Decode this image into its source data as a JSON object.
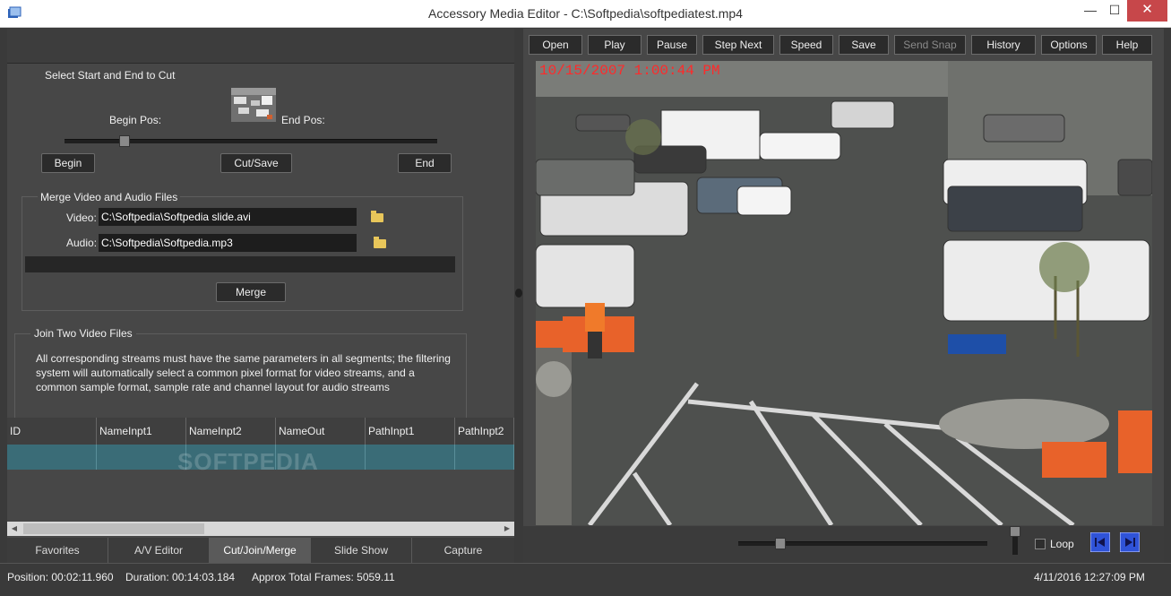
{
  "window": {
    "title": "Accessory Media Editor - C:\\Softpedia\\softpediatest.mp4",
    "min": "—",
    "max": "☐",
    "close": "✕"
  },
  "cut": {
    "heading": "Select Start and End to Cut",
    "begin_pos": "Begin Pos:",
    "end_pos": "End Pos:",
    "begin_btn": "Begin",
    "cutsave_btn": "Cut/Save",
    "end_btn": "End",
    "slider_fraction": 0.16
  },
  "merge": {
    "heading": "Merge Video and Audio Files",
    "video_label": "Video:",
    "video_value": "C:\\Softpedia\\Softpedia slide.avi",
    "audio_label": "Audio:",
    "audio_value": "C:\\Softpedia\\Softpedia.mp3",
    "merge_btn": "Merge"
  },
  "join": {
    "heading": "Join Two Video Files",
    "description": "All corresponding streams must have the same parameters in all segments; the filtering system will automatically select a common pixel format for video streams, and a common sample format, sample rate and channel layout for audio streams"
  },
  "grid": {
    "columns": [
      "ID",
      "NameInpt1",
      "NameInpt2",
      "NameOut",
      "PathInpt1",
      "PathInpt2"
    ]
  },
  "watermark": "SOFTPEDIA",
  "tabs": [
    "Favorites",
    "A/V Editor",
    "Cut/Join/Merge",
    "Slide Show",
    "Capture"
  ],
  "active_tab": "Cut/Join/Merge",
  "toolbar": {
    "open": "Open",
    "play": "Play",
    "pause": "Pause",
    "step_next": "Step Next",
    "speed": "Speed",
    "save": "Save",
    "send_snap": "Send Snap",
    "history": "History",
    "options": "Options",
    "help": "Help"
  },
  "video": {
    "overlay_timestamp": "10/15/2007 1:00:44 PM"
  },
  "player": {
    "seek_fraction": 0.17,
    "loop_label": "Loop",
    "loop_checked": false
  },
  "status": {
    "position": "Position: 00:02:11.960",
    "duration": "Duration: 00:14:03.184",
    "frames": "Approx Total Frames: 5059.11",
    "datetime": "4/11/2016 12:27:09 PM"
  },
  "colors": {
    "selected_row": "#3a6c77",
    "timestamp_red": "#ff2a2a",
    "nav_blue": "#2f53d8"
  }
}
